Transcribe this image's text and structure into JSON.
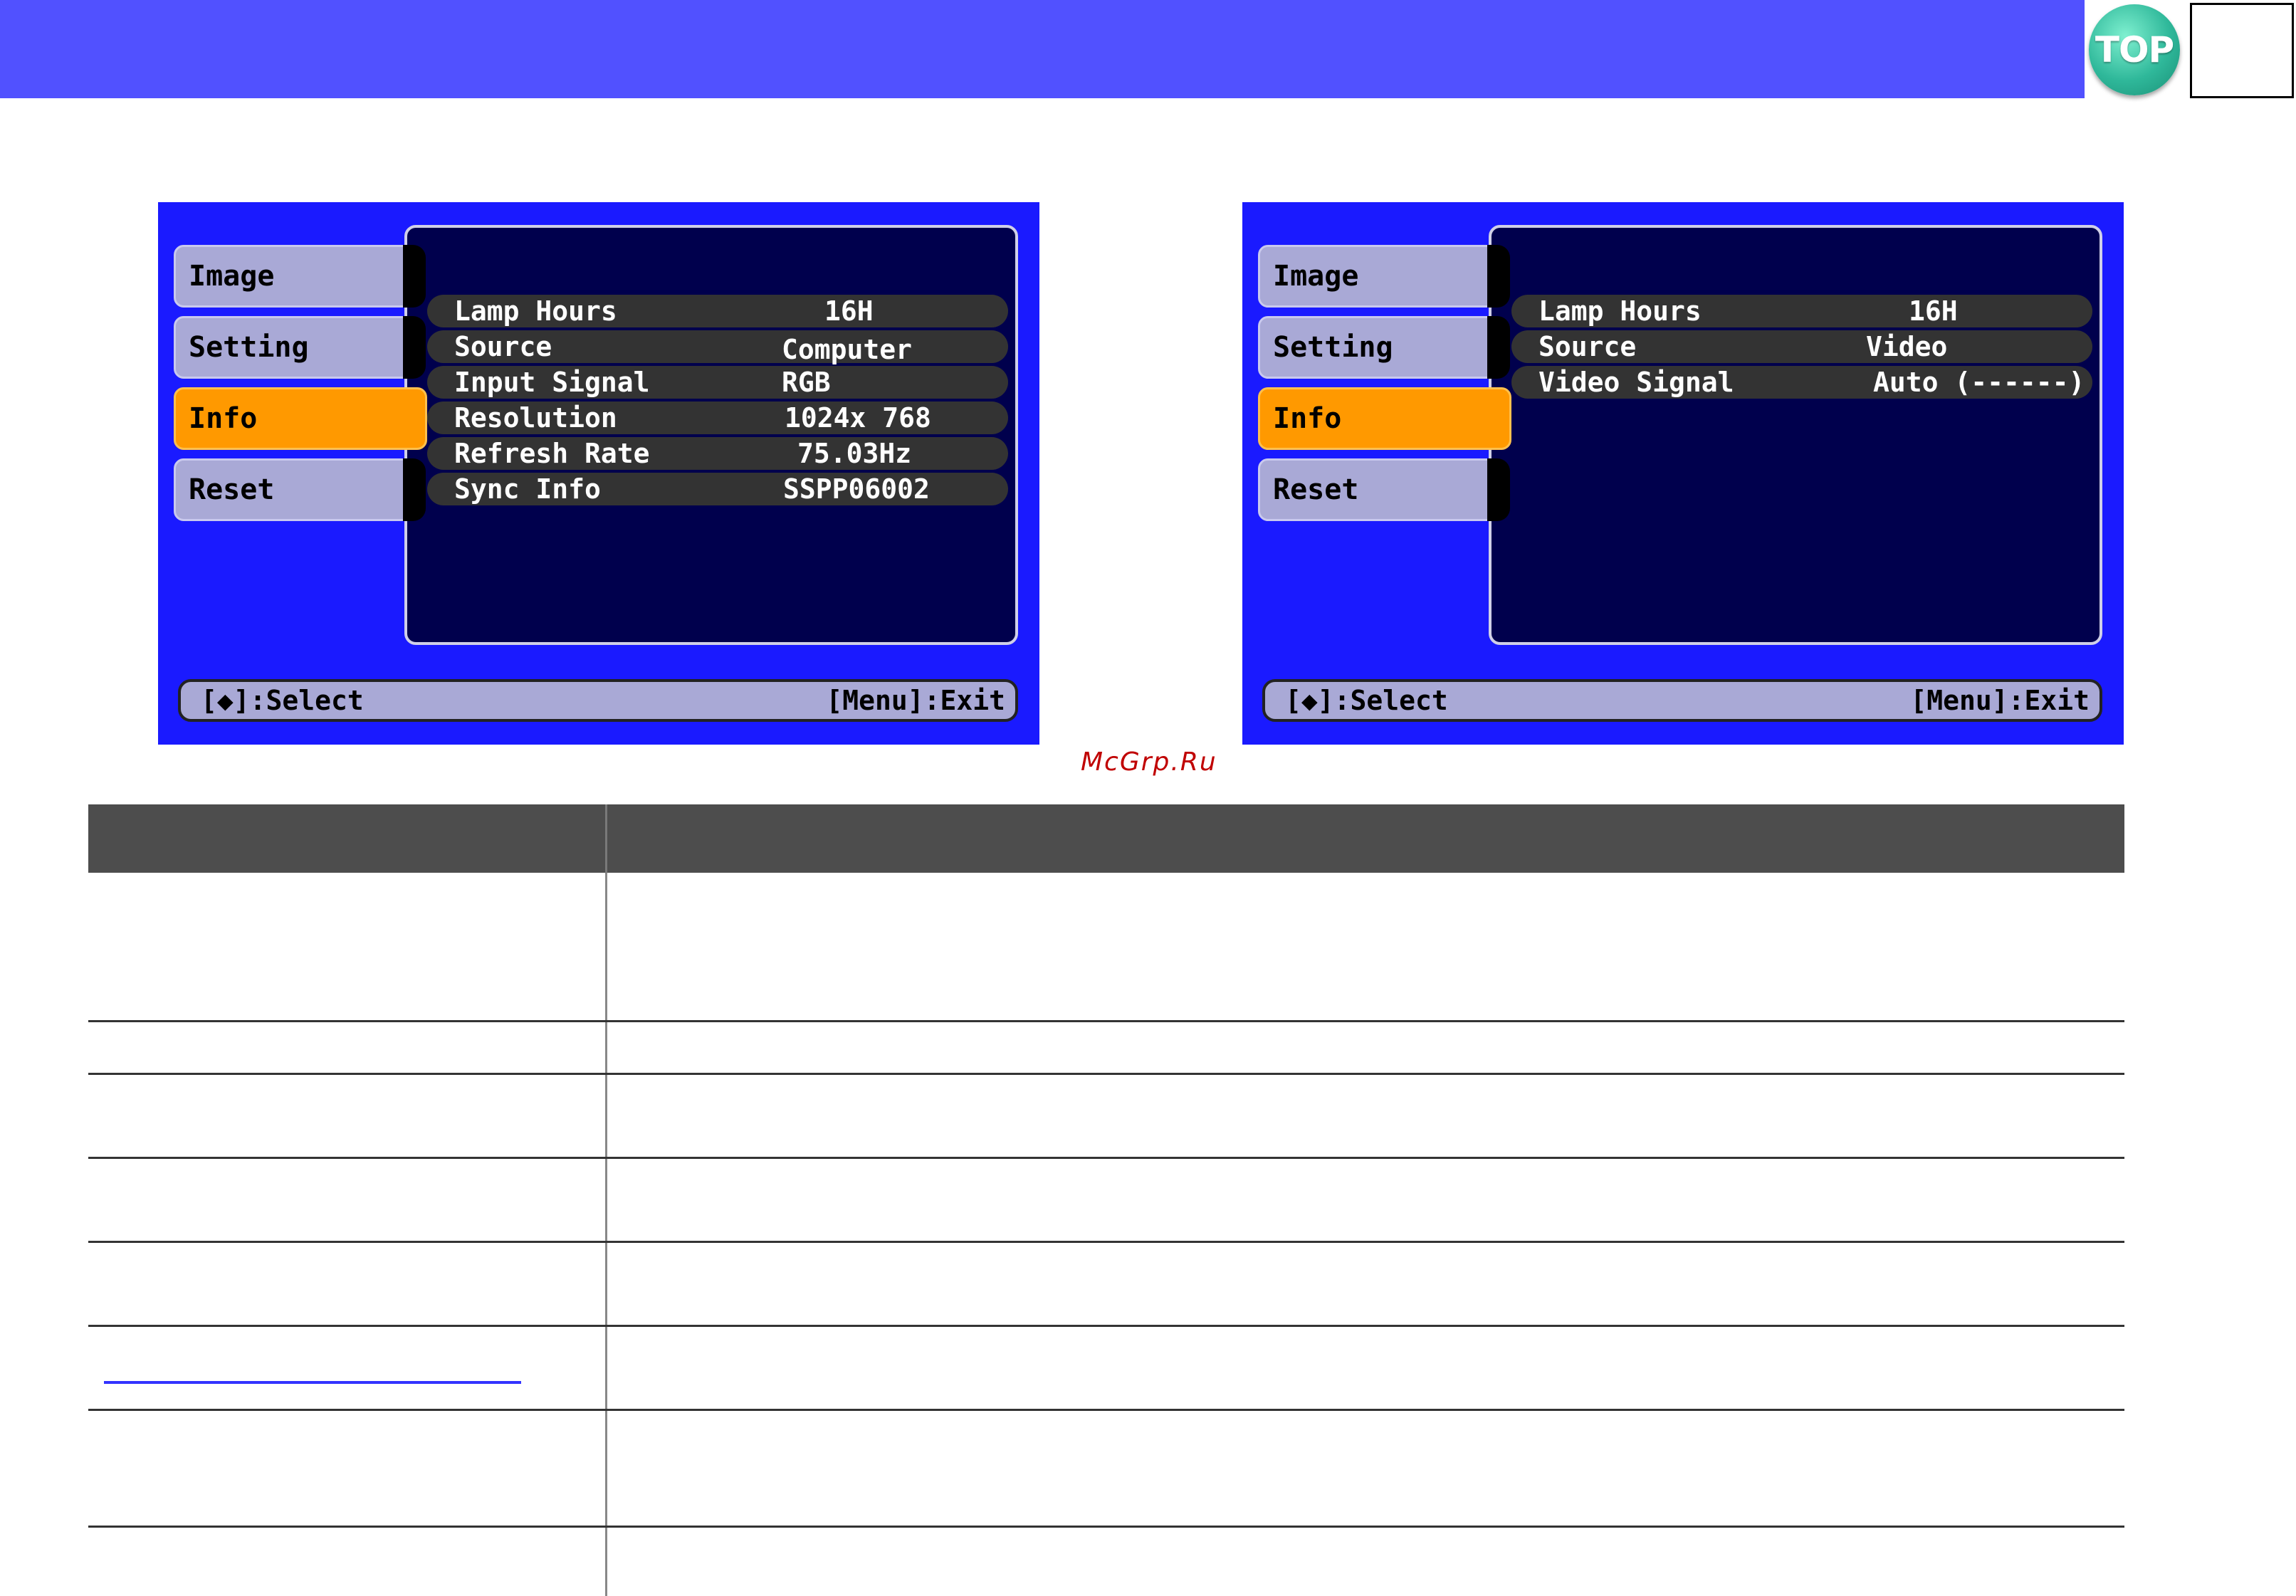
{
  "header": {
    "top_button_label": "TOP",
    "page_number": ""
  },
  "watermark": "McGrp.Ru",
  "osd_computer": {
    "tabs": [
      "Image",
      "Setting",
      "Info",
      "Reset"
    ],
    "active_tab": "Info",
    "rows": [
      {
        "label": "Lamp Hours",
        "value": "16H"
      },
      {
        "label": "Source",
        "value": "Computer"
      },
      {
        "label": "Input Signal",
        "value": "RGB"
      },
      {
        "label": "Resolution",
        "value": "1024x 768"
      },
      {
        "label": "Refresh Rate",
        "value": "75.03Hz"
      },
      {
        "label": "Sync Info",
        "value": "SSPP06002"
      }
    ],
    "footer_select": "[◆]:Select",
    "footer_exit": "[Menu]:Exit"
  },
  "osd_video": {
    "tabs": [
      "Image",
      "Setting",
      "Info",
      "Reset"
    ],
    "active_tab": "Info",
    "rows": [
      {
        "label": "Lamp Hours",
        "value": "16H"
      },
      {
        "label": "Source",
        "value": "Video"
      },
      {
        "label": "Video Signal",
        "value": "Auto (------)"
      }
    ],
    "footer_select": "[◆]:Select",
    "footer_exit": "[Menu]:Exit"
  },
  "colors": {
    "header": "#5151ff",
    "osd_background": "#1a1aff",
    "osd_panel": "#00004d",
    "tab": "#a9a9d6",
    "active_tab": "#ff9900",
    "table_header": "#4d4d4d",
    "link": "#3333ff"
  }
}
